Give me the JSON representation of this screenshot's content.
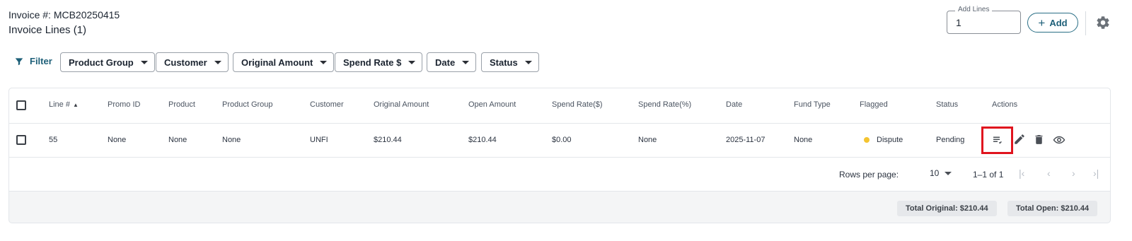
{
  "header": {
    "invoice_number": "Invoice #: MCB20250415",
    "invoice_lines": "Invoice Lines (1)"
  },
  "add_lines": {
    "legend": "Add Lines",
    "value": "1",
    "add_button_label": "Add"
  },
  "filters": {
    "label": "Filter",
    "chips": [
      "Product Group",
      "Customer",
      "Original Amount",
      "Spend Rate $",
      "Date",
      "Status"
    ]
  },
  "table": {
    "headers": {
      "line": "Line #",
      "promo_id": "Promo ID",
      "product": "Product",
      "product_group": "Product Group",
      "customer": "Customer",
      "original_amount": "Original Amount",
      "open_amount": "Open Amount",
      "spend_rate_dollar": "Spend Rate($)",
      "spend_rate_pct": "Spend Rate(%)",
      "date": "Date",
      "fund_type": "Fund Type",
      "flagged": "Flagged",
      "status": "Status",
      "actions": "Actions"
    },
    "rows": [
      {
        "line": "55",
        "promo_id": "None",
        "product": "None",
        "product_group": "None",
        "customer": "UNFI",
        "original_amount": "$210.44",
        "open_amount": "$210.44",
        "spend_rate_dollar": "$0.00",
        "spend_rate_pct": "None",
        "date": "2025-11-07",
        "fund_type": "None",
        "flagged": "Dispute",
        "status": "Pending"
      }
    ]
  },
  "pagination": {
    "rows_per_page_label": "Rows per page:",
    "rows_per_page": "10",
    "range": "1–1 of 1"
  },
  "totals": {
    "original": "Total Original: $210.44",
    "open": "Total Open: $210.44"
  },
  "colors": {
    "accent": "#1d5f78",
    "flag_dot": "#f4c430",
    "highlight": "#e0141e"
  }
}
